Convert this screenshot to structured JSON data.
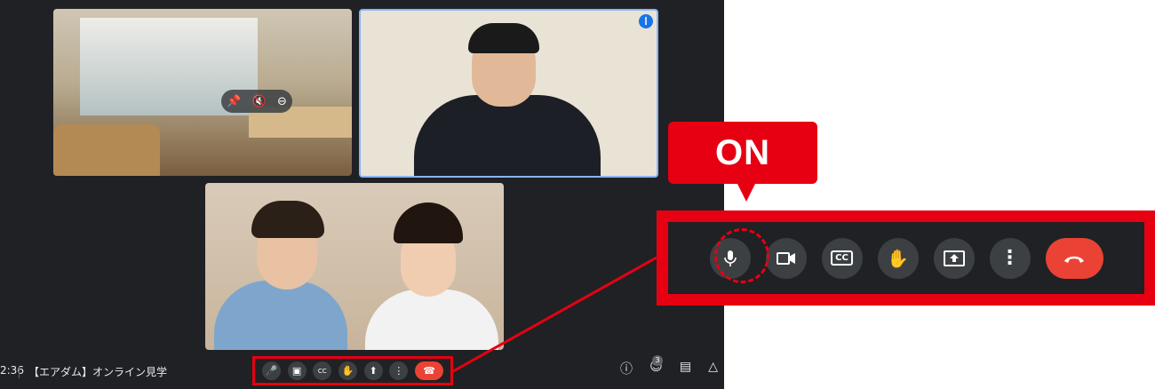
{
  "meet": {
    "clock": "2:36",
    "meeting_name": "【エアダム】オンライン見学",
    "participant_count": "3",
    "participants": [
      "room-view",
      "presenter-headset",
      "couple"
    ],
    "tile_icons": [
      "pin-icon",
      "mic-off-icon",
      "minus-circle-icon"
    ],
    "controls": [
      "mic-icon",
      "camera-icon",
      "captions-icon",
      "raise-hand-icon",
      "present-icon",
      "more-icon",
      "end-call-icon"
    ],
    "right_icons": [
      "info-icon",
      "people-icon",
      "chat-icon",
      "activities-icon"
    ]
  },
  "callout": {
    "label": "ON",
    "accent": "#e60012"
  },
  "icons": {
    "cc": "CC"
  }
}
